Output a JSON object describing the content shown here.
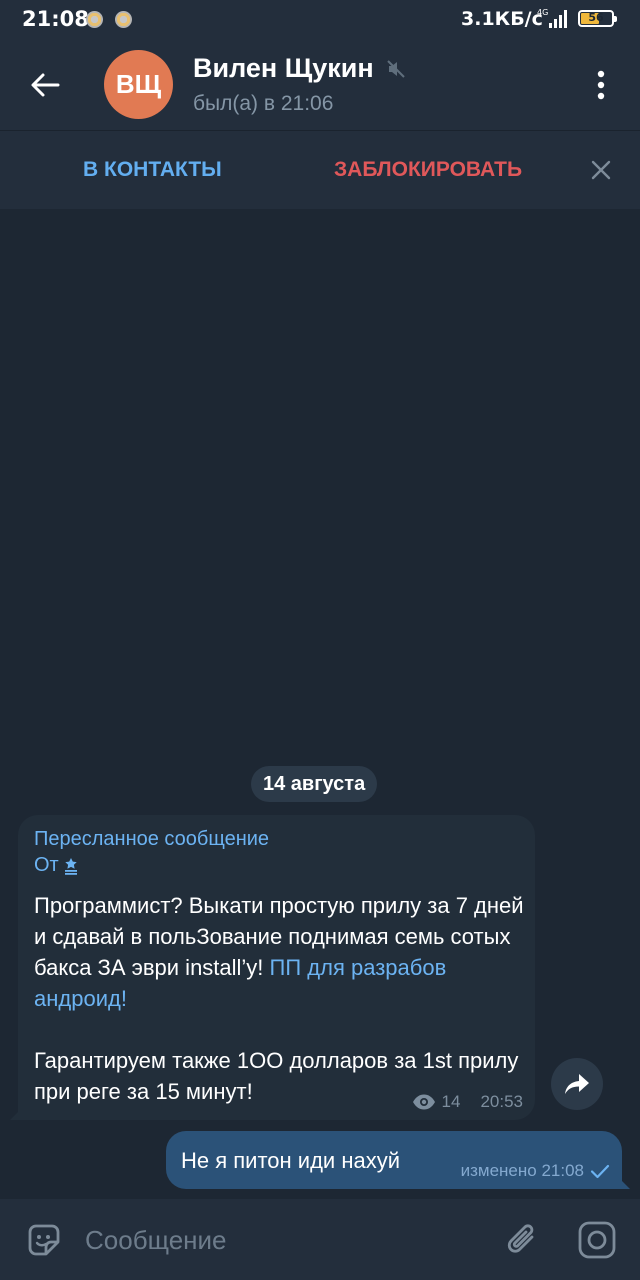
{
  "status": {
    "time": "21:08",
    "speed": "3.1КБ/с",
    "network": "4G",
    "battery": "56"
  },
  "header": {
    "avatar_initials": "ВЩ",
    "name": "Вилен Щукин",
    "last_seen": "был(а) в 21:06"
  },
  "actions": {
    "add_contact": "В КОНТАКТЫ",
    "block": "ЗАБЛОКИРОВАТЬ"
  },
  "date_chip": "14 августа",
  "forwarded": {
    "label": "Пересланное сообщение",
    "from_prefix": "От",
    "text_part1": "Программист? Выкати простую прилу за 7 дней и сдавай в польЗование поднимая семь сотых бакса ЗА эври install’у! ",
    "link_text": "ПП для разрабов андроид!",
    "text_part2": "\n\nГарантируем также 1OO долларов за 1st прилу при реге за 15 минут!",
    "views": "14",
    "time": "20:53"
  },
  "outgoing": {
    "text": "Не я питон иди нахуй",
    "meta": "изменено 21:08"
  },
  "composer": {
    "placeholder": "Сообщение"
  },
  "colors": {
    "background": "#1d2733",
    "bar": "#232e3c",
    "accent_blue": "#63aef0",
    "danger_red": "#e0585a",
    "avatar": "#e17a53",
    "outgoing_bubble": "#2b5278",
    "incoming_bubble": "#222e3a"
  }
}
